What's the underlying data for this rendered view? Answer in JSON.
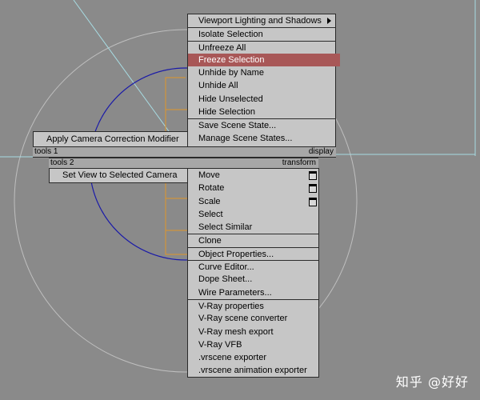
{
  "quad_top_right": {
    "items": [
      {
        "label": "Viewport Lighting and Shadows"
      },
      {
        "label": "Isolate Selection"
      },
      {
        "label": "Unfreeze All"
      },
      {
        "label": "Freeze Selection"
      },
      {
        "label": "Unhide by Name"
      },
      {
        "label": "Unhide All"
      },
      {
        "label": "Hide Unselected"
      },
      {
        "label": "Hide Selection"
      },
      {
        "label": "Save Scene State..."
      },
      {
        "label": "Manage Scene States..."
      }
    ],
    "header": "display",
    "highlighted_item": "Freeze Selection",
    "highlight_color": "#a85757"
  },
  "quad_top_left": {
    "items": [
      {
        "label": "Apply Camera Correction Modifier"
      }
    ],
    "header": "tools 1"
  },
  "quad_bottom_left": {
    "header": "tools 2",
    "items": [
      {
        "label": "Set View to Selected Camera"
      }
    ]
  },
  "quad_bottom_right": {
    "header": "transform",
    "items": [
      {
        "label": "Move",
        "has_options_icon": true
      },
      {
        "label": "Rotate",
        "has_options_icon": true
      },
      {
        "label": "Scale",
        "has_options_icon": true
      },
      {
        "label": "Select"
      },
      {
        "label": "Select Similar"
      },
      {
        "label": "Clone"
      },
      {
        "label": "Object Properties..."
      },
      {
        "label": "Curve Editor..."
      },
      {
        "label": "Dope Sheet..."
      },
      {
        "label": "Wire Parameters..."
      },
      {
        "label": "V-Ray properties"
      },
      {
        "label": "V-Ray scene converter"
      },
      {
        "label": "V-Ray mesh export"
      },
      {
        "label": "V-Ray VFB"
      },
      {
        "label": ".vrscene exporter"
      },
      {
        "label": ".vrscene animation exporter"
      }
    ]
  },
  "watermark": "知乎 @好好",
  "colors": {
    "viewport_bg": "#8a8a8a",
    "menu_bg": "#c6c6c6",
    "header_bg": "#a7a7a7",
    "selection_blue": "#1a1aa8",
    "helper_orange": "#e0952a",
    "camera_lines": "#9fd8e0"
  }
}
